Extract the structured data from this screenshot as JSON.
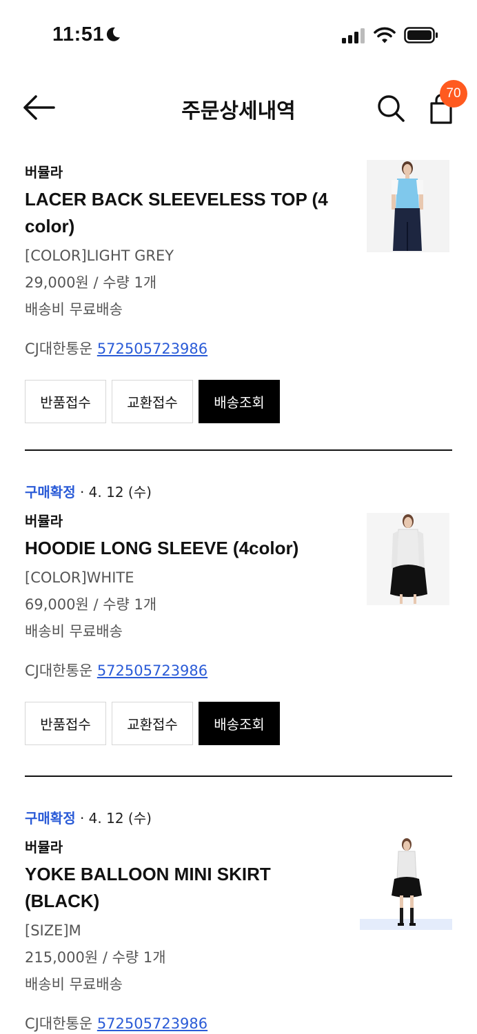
{
  "status_bar": {
    "time": "11:51"
  },
  "header": {
    "title": "주문상세내역",
    "cart_count": "70"
  },
  "orders": [
    {
      "status": "",
      "date": "",
      "brand": "버뮬라",
      "name": "LACER BACK SLEEVELESS TOP (4 color)",
      "option": "[COLOR]LIGHT GREY",
      "price_qty": "29,000원 / 수량 1개",
      "shipping": "배송비 무료배송",
      "courier": "CJ대한통운 ",
      "tracking": "572505723986",
      "buttons": [
        "반품접수",
        "교환접수",
        "배송조회"
      ]
    },
    {
      "status": "구매확정",
      "date": " · 4. 12 (수)",
      "brand": "버뮬라",
      "name": "HOODIE LONG SLEEVE (4color)",
      "option": "[COLOR]WHITE",
      "price_qty": "69,000원 / 수량 1개",
      "shipping": "배송비 무료배송",
      "courier": "CJ대한통운 ",
      "tracking": "572505723986",
      "buttons": [
        "반품접수",
        "교환접수",
        "배송조회"
      ]
    },
    {
      "status": "구매확정",
      "date": " · 4. 12 (수)",
      "brand": "버뮬라",
      "name": "YOKE BALLOON MINI SKIRT (BLACK)",
      "option": "[SIZE]M",
      "price_qty": "215,000원 / 수량 1개",
      "shipping": "배송비 무료배송",
      "courier": "CJ대한통운 ",
      "tracking": "572505723986"
    }
  ],
  "colors": {
    "accent_blue": "#2a5bd7",
    "badge_orange": "#ff5a1f"
  }
}
